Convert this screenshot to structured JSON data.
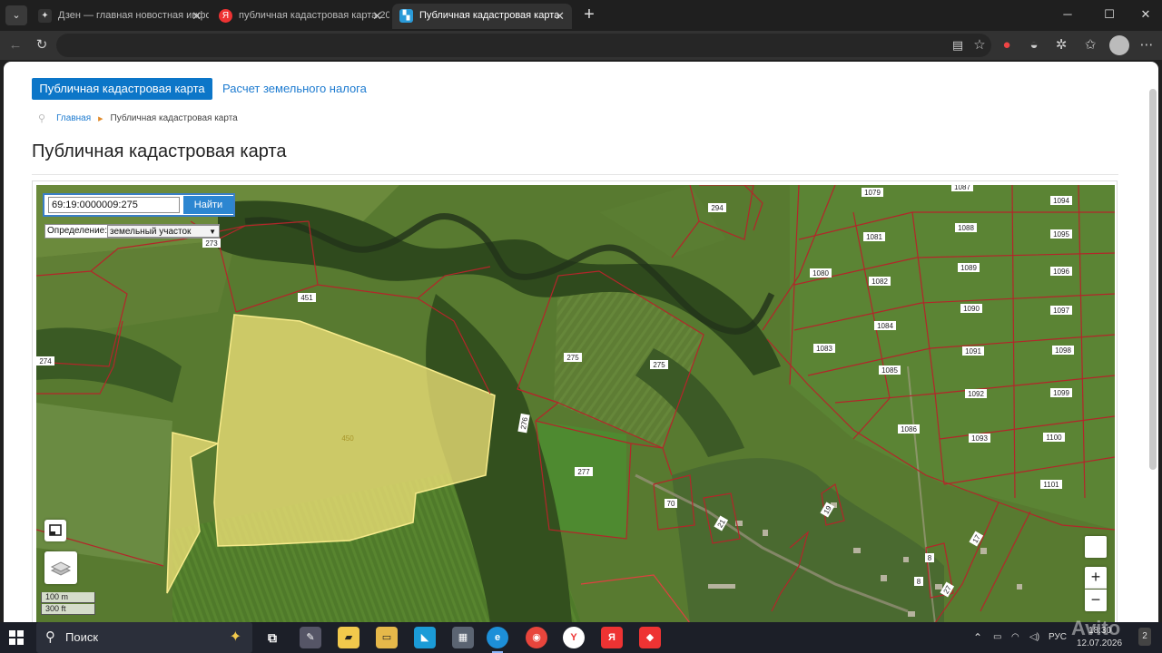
{
  "browser": {
    "tabs": [
      {
        "title": "Дзен — главная новостная инфо",
        "favicon": "dzen-icon",
        "active": false
      },
      {
        "title": "публичная кадастровая карта 20",
        "favicon": "yandex-icon",
        "active": false
      },
      {
        "title": "Публичная кадастровая карта",
        "favicon": "site-icon",
        "active": true
      }
    ],
    "new_tab": "+",
    "window_controls": [
      "─",
      "☐",
      "✕"
    ]
  },
  "site": {
    "nav": {
      "active_label": "Публичная кадастровая карта",
      "link_label": "Расчет земельного налога"
    },
    "breadcrumb": {
      "home": "Главная",
      "current": "Публичная кадастровая карта"
    },
    "title": "Публичная кадастровая карта"
  },
  "map": {
    "search": {
      "value": "69:19:0000009:275",
      "button": "Найти"
    },
    "definition": {
      "label": "Определение:",
      "value": "земельный участок"
    },
    "zoom_in": "+",
    "zoom_out": "−",
    "scale": {
      "metric": "100 m",
      "imperial": "300 ft"
    },
    "highlighted_parcel": "450",
    "parcel_labels": {
      "p294": "294",
      "p1079": "1079",
      "p1087": "1087",
      "p1094": "1094",
      "p273": "273",
      "p1081": "1081",
      "p1088": "1088",
      "p1095": "1095",
      "p451": "451",
      "p1080": "1080",
      "p1082": "1082",
      "p1089": "1089",
      "p1096": "1096",
      "p1090": "1090",
      "p1097": "1097",
      "p274": "274",
      "p1083": "1083",
      "p1084": "1084",
      "p1091": "1091",
      "p1098": "1098",
      "p275a": "275",
      "p275b": "275",
      "p1085": "1085",
      "p1092": "1092",
      "p1099": "1099",
      "p276": "276",
      "p1086": "1086",
      "p1093": "1093",
      "p1100": "1100",
      "p277": "277",
      "p1101": "1101",
      "p70": "70",
      "p19": "19",
      "p21": "21",
      "p8a": "8",
      "p8b": "8",
      "p17": "17",
      "p27": "27"
    }
  },
  "taskbar": {
    "search_label": "Поиск",
    "language": "РУС",
    "time": "18:30",
    "date": "12.07.2026",
    "notifications": "2"
  },
  "watermark": "Avito",
  "colors": {
    "accent": "#0c76c8",
    "link": "#1d7bd0",
    "parcel_border": "#b3262a",
    "selected_fill": "#f3e47a"
  }
}
